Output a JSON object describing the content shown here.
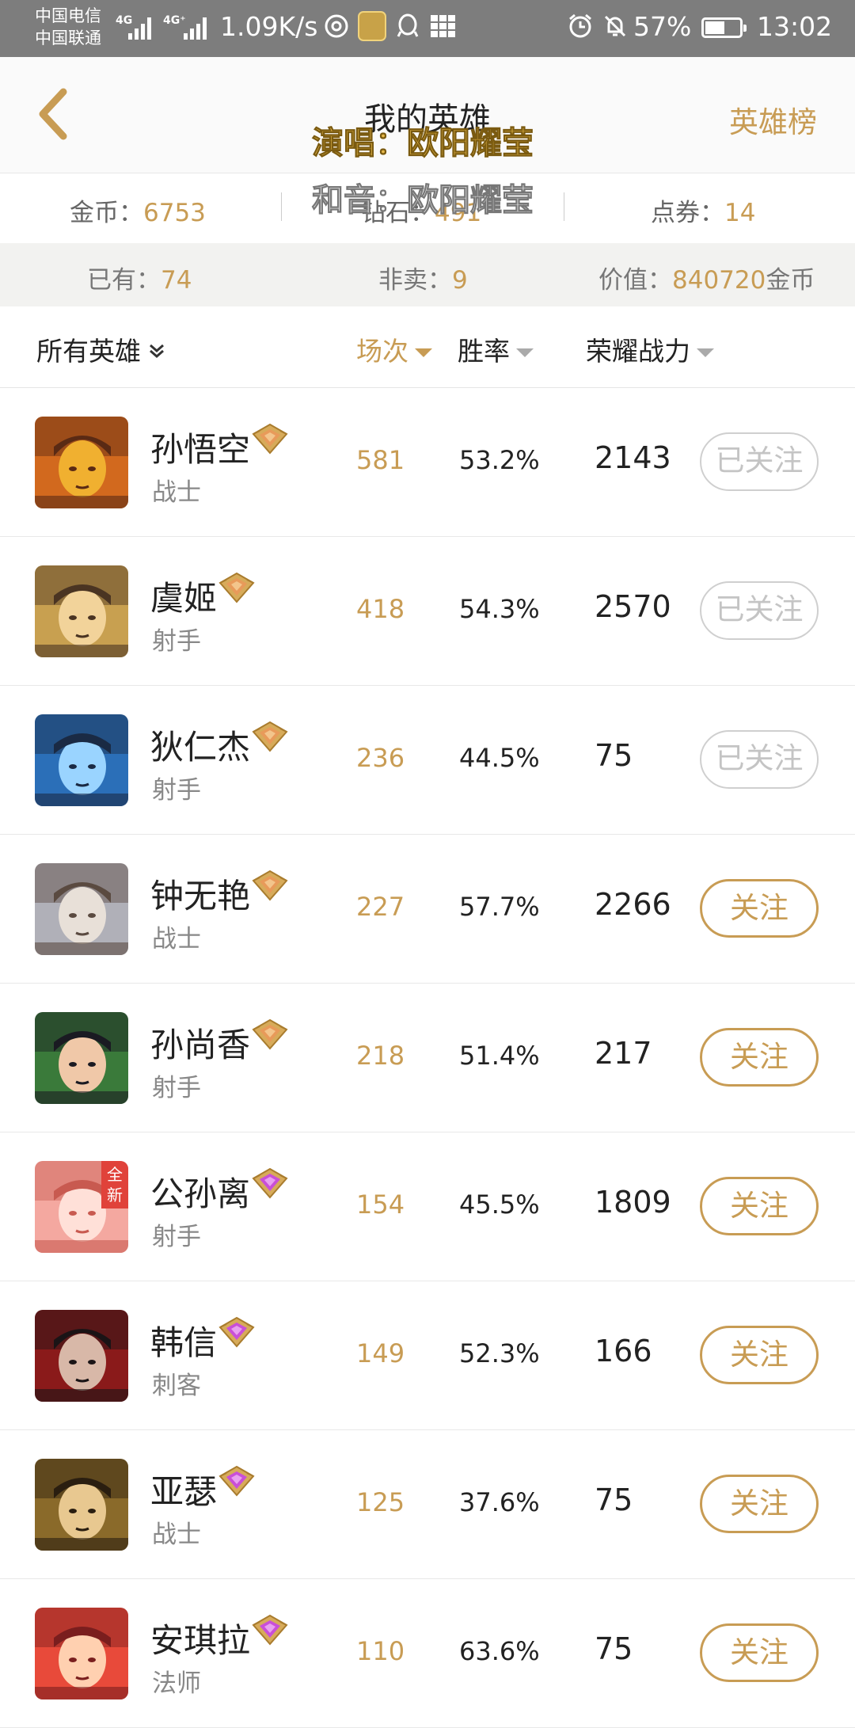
{
  "status_bar": {
    "carrier1": "中国电信",
    "carrier2": "中国联通",
    "net1": "4G",
    "net2": "4G⁺",
    "speed": "1.09K/s",
    "battery_pct": "57%",
    "battery_level": 0.57,
    "time": "13:02",
    "icons": [
      "netease-music-icon",
      "game-app-icon",
      "qq-icon",
      "grid-icon",
      "alarm-icon",
      "mute-bell-icon",
      "battery-icon"
    ]
  },
  "header": {
    "title": "我的英雄",
    "right_link": "英雄榜"
  },
  "lyrics": {
    "line1": "演唱：欧阳耀莹",
    "line2": "和音：欧阳耀莹"
  },
  "currency": {
    "gold_label": "金币：",
    "gold_value": "6753",
    "diamond_label": "钻石：",
    "diamond_value": "491",
    "coupon_label": "点券：",
    "coupon_value": "14"
  },
  "stats": {
    "owned_label": "已有：",
    "owned_value": "74",
    "nonsale_label": "非卖：",
    "nonsale_value": "9",
    "worth_label": "价值：",
    "worth_value": "840720",
    "worth_unit": "金币"
  },
  "filter": {
    "all_heroes": "所有英雄",
    "games": "场次",
    "winrate": "胜率",
    "power": "荣耀战力",
    "active_sort": "games"
  },
  "heroes": [
    {
      "name": "孙悟空",
      "role": "战士",
      "games": "581",
      "winrate": "53.2%",
      "power": "2143",
      "follow": "已关注",
      "followed": true,
      "rank": "gold",
      "new": false,
      "colors": [
        "#d2691e",
        "#f0b030",
        "#5a2a14"
      ]
    },
    {
      "name": "虞姬",
      "role": "射手",
      "games": "418",
      "winrate": "54.3%",
      "power": "2570",
      "follow": "已关注",
      "followed": true,
      "rank": "gold",
      "new": false,
      "colors": [
        "#c8a050",
        "#f2d39a",
        "#4a3422"
      ]
    },
    {
      "name": "狄仁杰",
      "role": "射手",
      "games": "236",
      "winrate": "44.5%",
      "power": "75",
      "follow": "已关注",
      "followed": true,
      "rank": "gold",
      "new": false,
      "colors": [
        "#2b6fb8",
        "#9ad4ff",
        "#1a2a44"
      ]
    },
    {
      "name": "钟无艳",
      "role": "战士",
      "games": "227",
      "winrate": "57.7%",
      "power": "2266",
      "follow": "关注",
      "followed": false,
      "rank": "gold",
      "new": false,
      "colors": [
        "#b0b0b8",
        "#e8e0d8",
        "#5a4a40"
      ]
    },
    {
      "name": "孙尚香",
      "role": "射手",
      "games": "218",
      "winrate": "51.4%",
      "power": "217",
      "follow": "关注",
      "followed": false,
      "rank": "gold",
      "new": false,
      "colors": [
        "#3a7a3a",
        "#f0c8a8",
        "#1a1a22"
      ]
    },
    {
      "name": "公孙离",
      "role": "射手",
      "games": "154",
      "winrate": "45.5%",
      "power": "1809",
      "follow": "关注",
      "followed": false,
      "rank": "purple",
      "new": true,
      "new_label": "全新",
      "colors": [
        "#f4a8a0",
        "#ffe0d8",
        "#c85a50"
      ]
    },
    {
      "name": "韩信",
      "role": "刺客",
      "games": "149",
      "winrate": "52.3%",
      "power": "166",
      "follow": "关注",
      "followed": false,
      "rank": "purple",
      "new": false,
      "colors": [
        "#8a1a1a",
        "#d8b8a8",
        "#1a1416"
      ]
    },
    {
      "name": "亚瑟",
      "role": "战士",
      "games": "125",
      "winrate": "37.6%",
      "power": "75",
      "follow": "关注",
      "followed": false,
      "rank": "purple",
      "new": false,
      "colors": [
        "#8a6a2a",
        "#e8c890",
        "#2a1e10"
      ]
    },
    {
      "name": "安琪拉",
      "role": "法师",
      "games": "110",
      "winrate": "63.6%",
      "power": "75",
      "follow": "关注",
      "followed": false,
      "rank": "purple",
      "new": false,
      "colors": [
        "#e84a3a",
        "#ffd0b0",
        "#7a1e1e"
      ]
    }
  ]
}
